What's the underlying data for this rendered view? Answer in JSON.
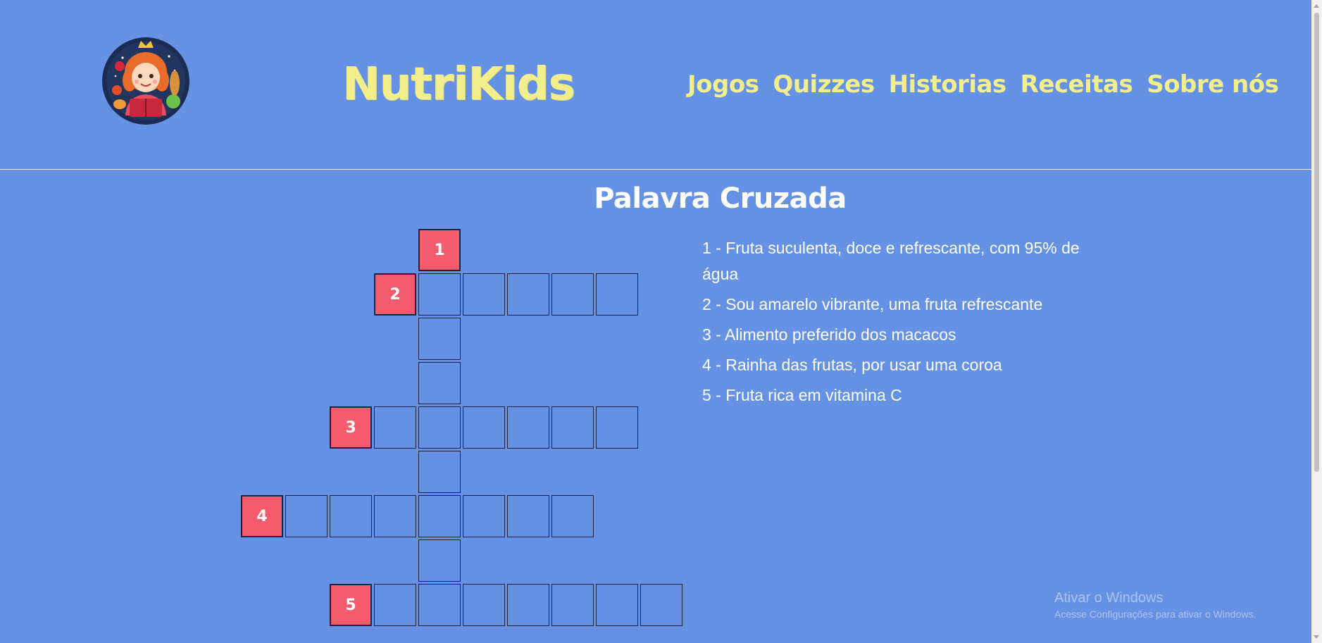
{
  "header": {
    "logo_alt": "NutriKids logo",
    "brand": "NutriKids",
    "nav": [
      "Jogos",
      "Quizzes",
      "Historias",
      "Receitas",
      "Sobre nós"
    ]
  },
  "puzzle": {
    "title": "Palavra Cruzada",
    "numbers": [
      "1",
      "2",
      "3",
      "4",
      "5"
    ],
    "clues": [
      "1 - Fruta suculenta, doce e refrescante, com 95% de água",
      "2 - Sou amarelo vibrante, uma fruta refrescante",
      "3 - Alimento preferido dos macacos",
      "4 - Rainha das frutas, por usar uma coroa",
      "5 - Fruta rica em vitamina C"
    ],
    "words": [
      {
        "number": "1",
        "direction": "down",
        "length": 8
      },
      {
        "number": "2",
        "direction": "across",
        "length": 5
      },
      {
        "number": "3",
        "direction": "across",
        "length": 6
      },
      {
        "number": "4",
        "direction": "across",
        "length": 7
      },
      {
        "number": "5",
        "direction": "across",
        "length": 7
      }
    ]
  },
  "watermark": {
    "title": "Ativar o Windows",
    "subtitle": "Acesse Configurações para ativar o Windows."
  },
  "colors": {
    "background": "#6692e5",
    "brand": "#f3ee8c",
    "number_cell": "#f45b6d",
    "cell_border": "#1d2340"
  }
}
